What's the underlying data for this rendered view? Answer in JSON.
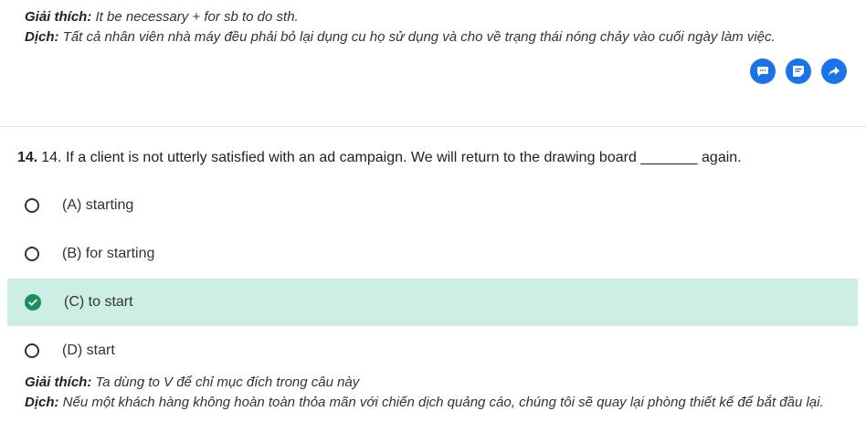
{
  "prev_explanation": {
    "giai_thich_label": "Giải thích:",
    "giai_thich_text": " It be necessary + for sb to do sth.",
    "dich_label": "Dịch:",
    "dich_text": " Tất cả nhân viên nhà máy đều phải bỏ lại dụng cu họ sử dụng và cho về trạng thái nóng chảy vào cuối ngày làm việc."
  },
  "actions": {
    "comment_icon": "comment-icon",
    "note_icon": "note-icon",
    "share_icon": "share-icon",
    "accent": "#1a73e8"
  },
  "question": {
    "number": "14.",
    "text": "14. If a client is not utterly satisfied with an ad campaign. We will return to the drawing board _______ again."
  },
  "options": [
    {
      "label": "(A) starting",
      "selected": false
    },
    {
      "label": "(B) for starting",
      "selected": false
    },
    {
      "label": "(C) to start",
      "selected": true
    },
    {
      "label": "(D) start",
      "selected": false
    }
  ],
  "explanation": {
    "giai_thich_label": "Giải thích:",
    "giai_thich_text": " Ta dùng to V để chỉ mục đích trong câu này",
    "dich_label": "Dịch:",
    "dich_text": " Nếu một khách hàng không hoàn toàn thỏa mãn với chiến dịch quảng cáo, chúng tôi sẽ quay lại phòng thiết kế để bắt đầu lại."
  },
  "colors": {
    "selected_bg": "#cdeee4",
    "check_green": "#1e8e5a"
  }
}
